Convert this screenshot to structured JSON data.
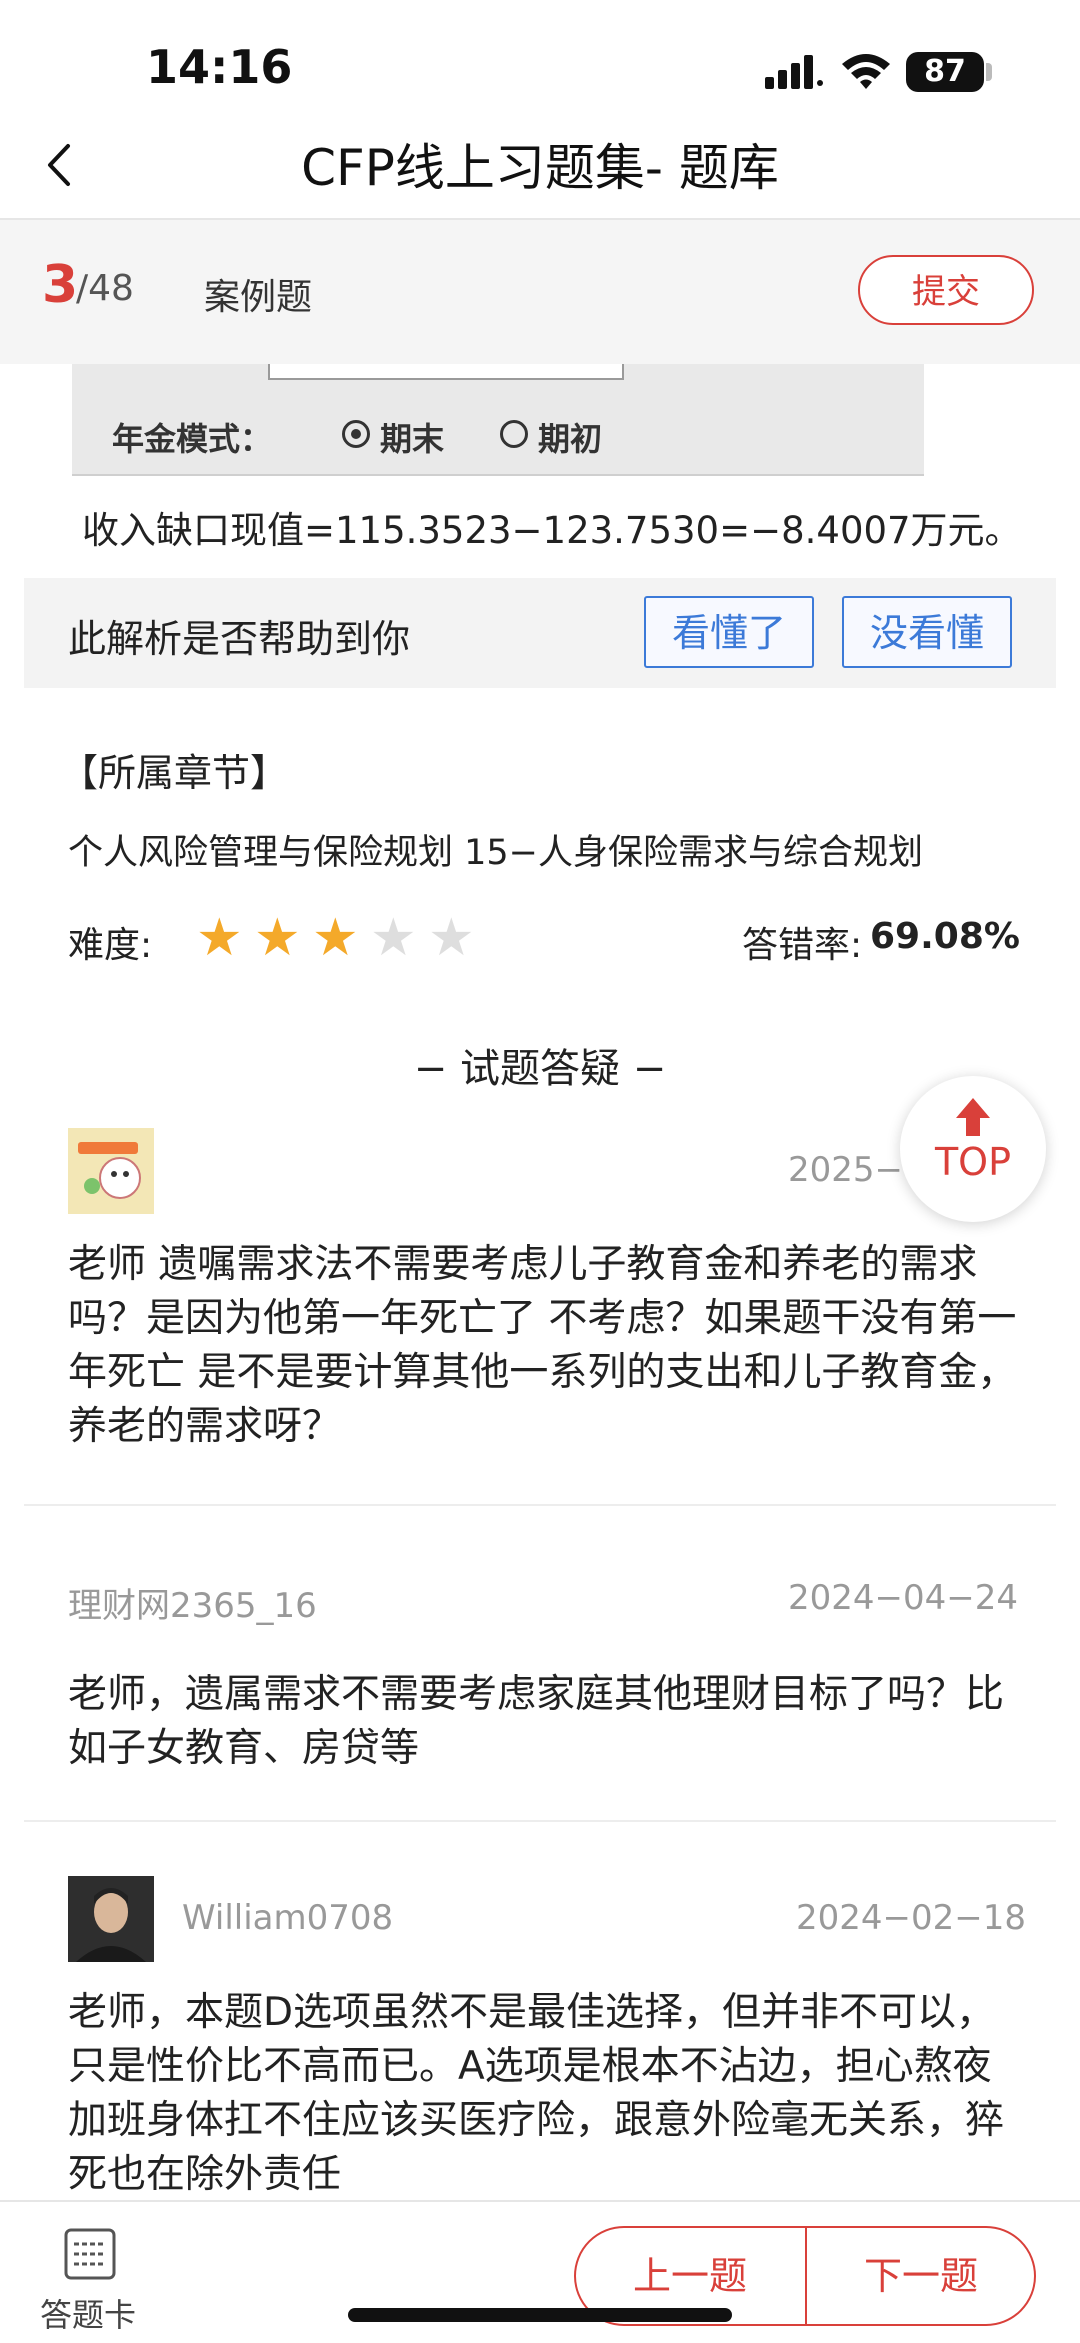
{
  "status_bar": {
    "time": "14:16",
    "battery": "87"
  },
  "nav": {
    "title": "CFP线上习题集- 题库"
  },
  "question_bar": {
    "current": "3",
    "total": "/48",
    "type": "案例题",
    "submit_label": "提交"
  },
  "analysis": {
    "image_label": "年金模式：",
    "radio_end": "期末",
    "radio_begin": "期初",
    "calc_text": "收入缺口现值=115.3523−123.7530=−8.4007万元。"
  },
  "helpful": {
    "question": "此解析是否帮助到你",
    "understood_label": "看懂了",
    "not_understood_label": "没看懂"
  },
  "chapter": {
    "heading": "【所属章节】",
    "value": "个人风险管理与保险规划 15−人身保险需求与综合规划"
  },
  "difficulty": {
    "label": "难度:",
    "rating": 3,
    "max": 5,
    "error_rate_label": "答错率:",
    "error_rate_value": "69.08%"
  },
  "qa_heading": "− 试题答疑 −",
  "top_button": {
    "label": "TOP"
  },
  "comments": [
    {
      "user": "",
      "date": "2025−0",
      "text": "老师 遗嘱需求法不需要考虑儿子教育金和养老的需求吗？是因为他第一年死亡了 不考虑？如果题干没有第一年死亡 是不是要计算其他一系列的支出和儿子教育金，养老的需求呀？"
    },
    {
      "user": "理财网2365_16",
      "date": "2024−04−24",
      "text": "老师，遗属需求不需要考虑家庭其他理财目标了吗？比如子女教育、房贷等"
    },
    {
      "user": "William0708",
      "date": "2024−02−18",
      "text": "老师，本题D选项虽然不是最佳选择，但并非不可以，只是性价比不高而已。A选项是根本不沾边，担心熬夜加班身体扛不住应该买医疗险，跟意外险毫无关系，猝死也在除外责任"
    }
  ],
  "bottom_bar": {
    "card_label": "答题卡",
    "prev_label": "上一题",
    "next_label": "下一题"
  },
  "colors": {
    "accent": "#d9403a",
    "link_blue": "#3c7ad8",
    "star": "#f4a92a"
  }
}
